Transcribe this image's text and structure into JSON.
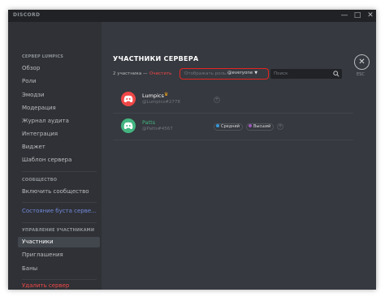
{
  "window": {
    "app_title": "DISCORD",
    "controls": {
      "minimize": "—",
      "maximize": "□",
      "close": "✕"
    }
  },
  "sidebar": {
    "server_section": "СЕРВЕР LUMPICS",
    "server_items": [
      "Обзор",
      "Роли",
      "Эмодзи",
      "Модерация",
      "Журнал аудита",
      "Интеграция",
      "Виджет",
      "Шаблон сервера"
    ],
    "community_section": "СООБЩЕСТВО",
    "community_item": "Включить сообщество",
    "boost_item": "Состояние буста серве...",
    "members_section": "УПРАВЛЕНИЕ УЧАСТНИКАМИ",
    "members_items": [
      "Участники",
      "Приглашения",
      "Баны"
    ],
    "active_item": "Участники",
    "delete_item": "Удалить сервер"
  },
  "main": {
    "title": "УЧАСТНИКИ СЕРВЕРА",
    "count_text": "2 участника —",
    "clear_text": "Очистить",
    "role_filter_label": "Отображать роль:",
    "role_filter_value": "@everyone",
    "search_placeholder": "Поиск",
    "esc_label": "ESC",
    "members": [
      {
        "name": "Lumpics",
        "tag": "@Lumpics#2778",
        "owner": true,
        "avatar_color": "#f04747",
        "roles": []
      },
      {
        "name": "Patts",
        "tag": "@Patts#4567",
        "owner": false,
        "avatar_color": "#43b581",
        "roles": [
          {
            "name": "Средний",
            "color": "#3498db"
          },
          {
            "name": "Высший",
            "color": "#9b59b6"
          }
        ]
      }
    ]
  },
  "colors": {
    "accent": "#7289da",
    "danger": "#f04747",
    "highlight_border": "#e52521",
    "background": "#36393f",
    "sidebar": "#2f3136"
  },
  "icons": {
    "search": "search-icon",
    "close": "close-icon",
    "crown": "crown-icon",
    "add_role": "plus-circle-icon",
    "chevron": "chevron-down-icon"
  }
}
